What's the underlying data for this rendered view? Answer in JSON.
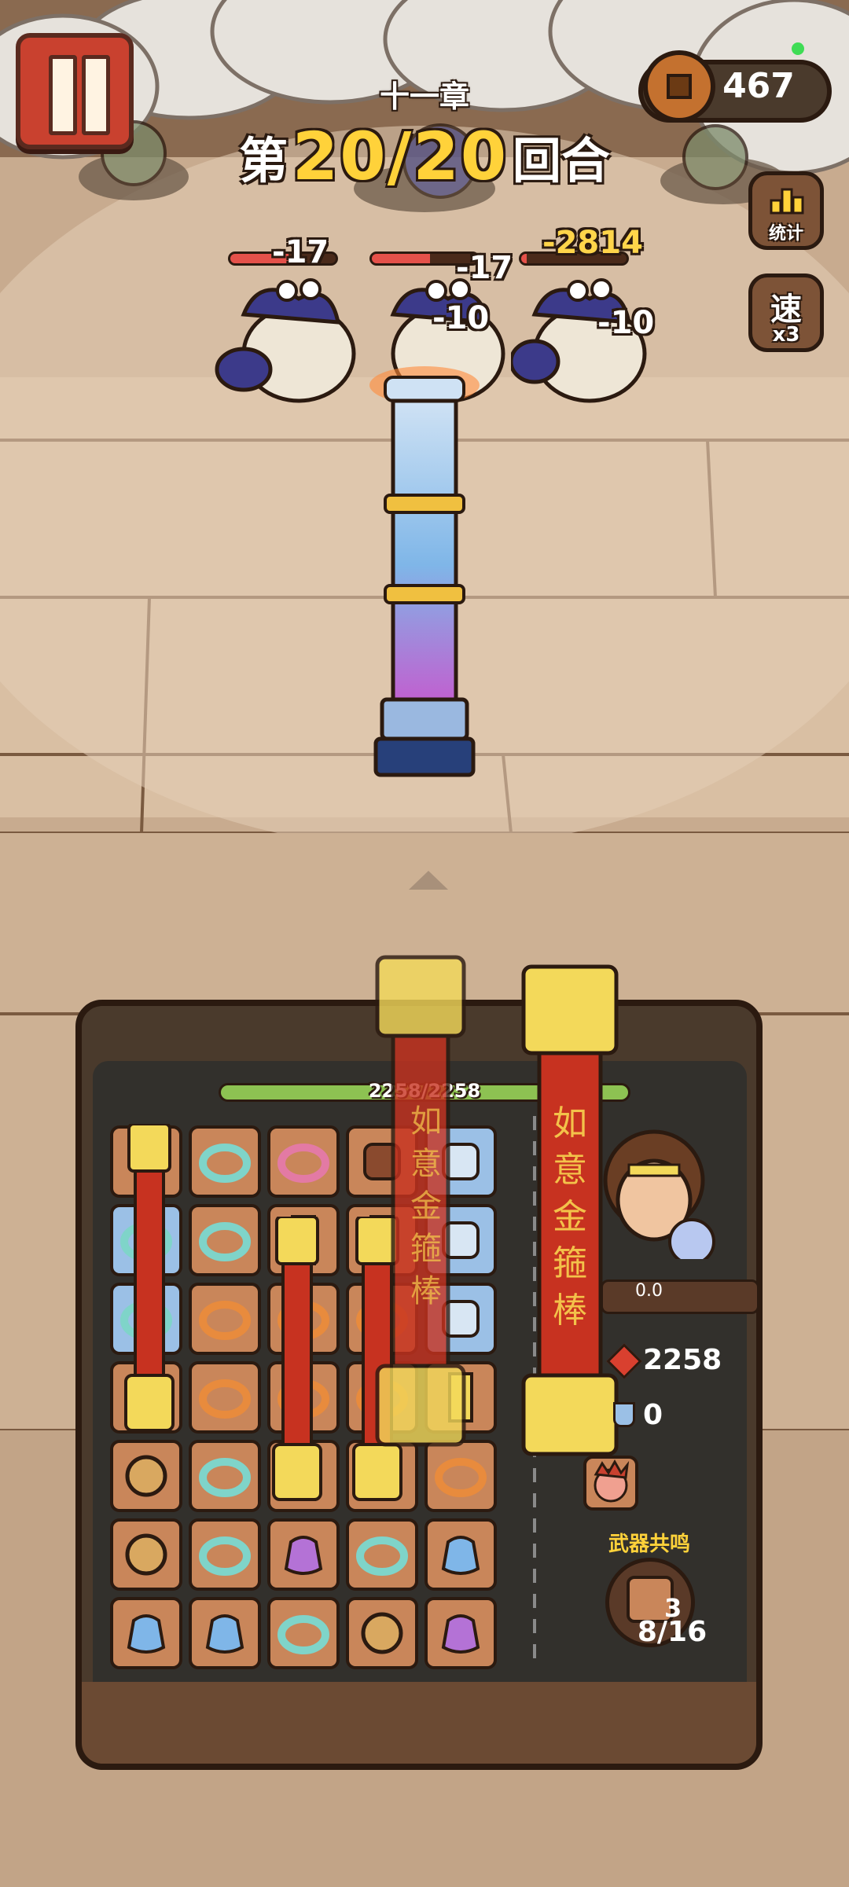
{
  "hud": {
    "chapter": "十一章",
    "round_prefix": "第",
    "round_value": "20/20",
    "round_suffix": "回合",
    "coins": "467",
    "stats_label": "统计",
    "speed_icon_label": "速",
    "speed_value": "x3"
  },
  "enemies": [
    {
      "hp_fraction": 0.55,
      "damage_top": "-17",
      "damage_mid": ""
    },
    {
      "hp_fraction": 0.55,
      "damage_top": "-17",
      "damage_mid": "-10"
    },
    {
      "hp_fraction": 0.05,
      "damage_top": "-2814",
      "damage_mid": "-10"
    }
  ],
  "player": {
    "hp_text": "2258/2258",
    "hp_fraction": 1.0,
    "charge": "0.0",
    "attack": "2258",
    "defense": "0"
  },
  "weapon_text": "如意金箍棒",
  "resonance": {
    "label": "武器共鸣",
    "level": "3",
    "progress": "8/16"
  },
  "board": {
    "rows": [
      [
        "staff",
        "bangle-teal",
        "bangle-pink",
        "scroll-red",
        "scroll-blue"
      ],
      [
        "bangle-teal",
        "bangle-teal",
        "staff",
        "staff",
        "scroll-blue"
      ],
      [
        "bangle-teal",
        "bangle-orange",
        "bangle-orange",
        "bangle-orange",
        "scroll-blue"
      ],
      [
        "staff",
        "bangle-orange",
        "bangle-orange",
        "bangle-orange",
        "staff"
      ],
      [
        "yinyang-coin",
        "bangle-teal",
        "staff",
        "staff",
        "bangle-orange"
      ],
      [
        "yinyang-coin",
        "bangle-teal",
        "pouch-purple",
        "bangle-teal",
        "pouch-blue"
      ],
      [
        "pouch-blue",
        "pouch-blue",
        "bangle-teal",
        "yinyang-coin",
        "pouch-purple"
      ]
    ]
  },
  "colors": {
    "accent_gold": "#ffd23a",
    "hp_green": "#8dc252",
    "enemy_hp_red": "#e5514a",
    "pause_red": "#c9412f"
  }
}
